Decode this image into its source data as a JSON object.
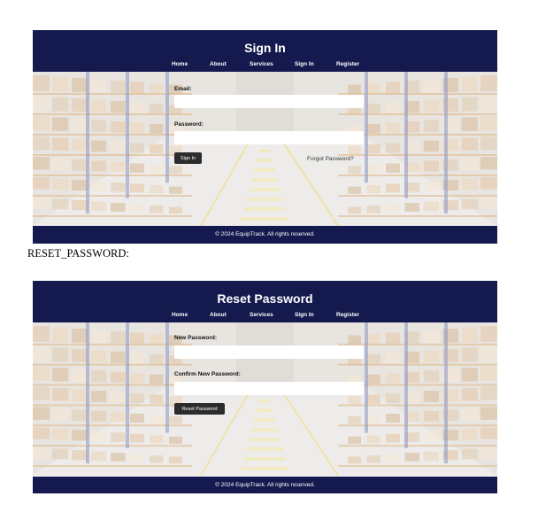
{
  "signin": {
    "title": "Sign In",
    "nav": [
      "Home",
      "About",
      "Services",
      "Sign In",
      "Register"
    ],
    "email_label": "Email:",
    "password_label": "Password:",
    "button_label": "Sign In",
    "forgot_link": "Forgot Password?",
    "footer": "© 2024 EquipTrack. All rights reserved."
  },
  "caption": "RESET_PASSWORD:",
  "reset": {
    "title": "Reset Password",
    "nav": [
      "Home",
      "About",
      "Services",
      "Sign In",
      "Register"
    ],
    "new_password_label": "New Password:",
    "confirm_password_label": "Confirm New Password:",
    "button_label": "Reset Password",
    "footer": "© 2024 EquipTrack. All rights reserved."
  },
  "colors": {
    "header": "#141a4e",
    "button": "#2c2c2c",
    "background_image": "warehouse-aisle"
  }
}
